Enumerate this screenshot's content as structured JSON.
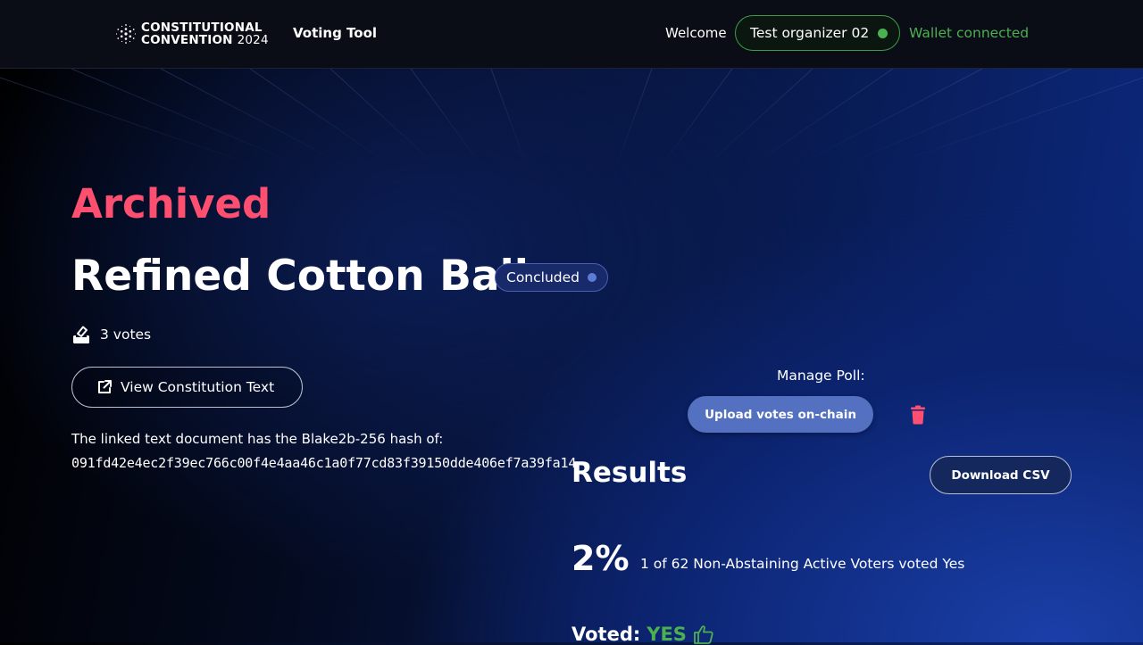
{
  "header": {
    "logo_line1": "CONSTITUTIONAL",
    "logo_line2": "CONVENTION",
    "logo_year": "2024",
    "nav_voting_tool": "Voting Tool",
    "welcome": "Welcome",
    "user_name": "Test organizer 02",
    "wallet_status": "Wallet connected"
  },
  "poll": {
    "state_heading": "Archived",
    "title": "Refined Cotton Ball",
    "status_badge": "Concluded",
    "votes_count": "3 votes",
    "view_text_button": "View Constitution Text",
    "hash_label": "The linked text document has the Blake2b-256 hash of:",
    "hash_value": "091fd42e4ec2f39ec766c00f4e4aa46c1a0f77cd83f39150dde406ef7a39fa14"
  },
  "manage": {
    "label": "Manage Poll:",
    "upload_button": "Upload votes on-chain"
  },
  "results": {
    "heading": "Results",
    "download_button": "Download CSV",
    "percentage": "2%",
    "description": "1 of 62 Non-Abstaining Active Voters voted Yes",
    "voted_label": "Voted:",
    "voted_choice": "YES"
  },
  "colors": {
    "archived": "#ff4f70",
    "wallet_green": "#4caf50",
    "upload_button": "#5470c0",
    "trash": "#ff4f70"
  },
  "icons": {
    "logo": "cardano-logo-icon",
    "votes": "ballot-icon",
    "external_link": "external-link-icon",
    "delete": "trash-icon",
    "voted": "thumbs-up-icon"
  }
}
